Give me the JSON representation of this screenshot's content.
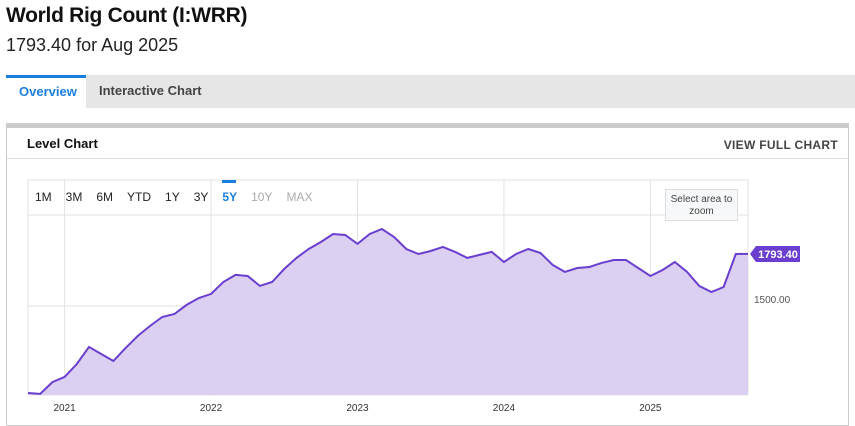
{
  "header": {
    "title": "World Rig Count (I:WRR)",
    "subtitle": "1793.40 for Aug 2025"
  },
  "tabs": [
    {
      "label": "Overview",
      "active": true
    },
    {
      "label": "Interactive Chart",
      "active": false
    }
  ],
  "card": {
    "title": "Level Chart",
    "link": "VIEW FULL CHART",
    "zoom_hint": "Select area to zoom"
  },
  "ranges": [
    "1M",
    "3M",
    "6M",
    "YTD",
    "1Y",
    "3Y",
    "5Y",
    "10Y",
    "MAX"
  ],
  "active_range": "5Y",
  "disabled_ranges": [
    "10Y",
    "MAX"
  ],
  "colors": {
    "line": "#6a3fcf",
    "fill": "#d9cdf1",
    "accent": "#1a7fe0"
  },
  "chart_data": {
    "type": "area",
    "title": "Level Chart",
    "ylim": [
      998,
      2013
    ],
    "yticks": [
      {
        "value": 1500,
        "label": "1500.00"
      }
    ],
    "xticks": [
      {
        "label": "2021",
        "index": 3
      },
      {
        "label": "2022",
        "index": 15
      },
      {
        "label": "2023",
        "index": 27
      },
      {
        "label": "2024",
        "index": 39
      },
      {
        "label": "2025",
        "index": 51
      }
    ],
    "last_label": "1793.40",
    "values": [
      1009,
      1004,
      1071,
      1100,
      1173,
      1269,
      1229,
      1190,
      1263,
      1331,
      1387,
      1438,
      1455,
      1506,
      1545,
      1568,
      1635,
      1675,
      1669,
      1613,
      1635,
      1709,
      1771,
      1821,
      1861,
      1906,
      1900,
      1850,
      1906,
      1934,
      1889,
      1821,
      1793,
      1810,
      1833,
      1805,
      1771,
      1788,
      1805,
      1748,
      1793,
      1821,
      1799,
      1731,
      1692,
      1714,
      1720,
      1743,
      1759,
      1759,
      1714,
      1669,
      1703,
      1748,
      1692,
      1613,
      1579,
      1607,
      1793,
      1793.4
    ]
  }
}
